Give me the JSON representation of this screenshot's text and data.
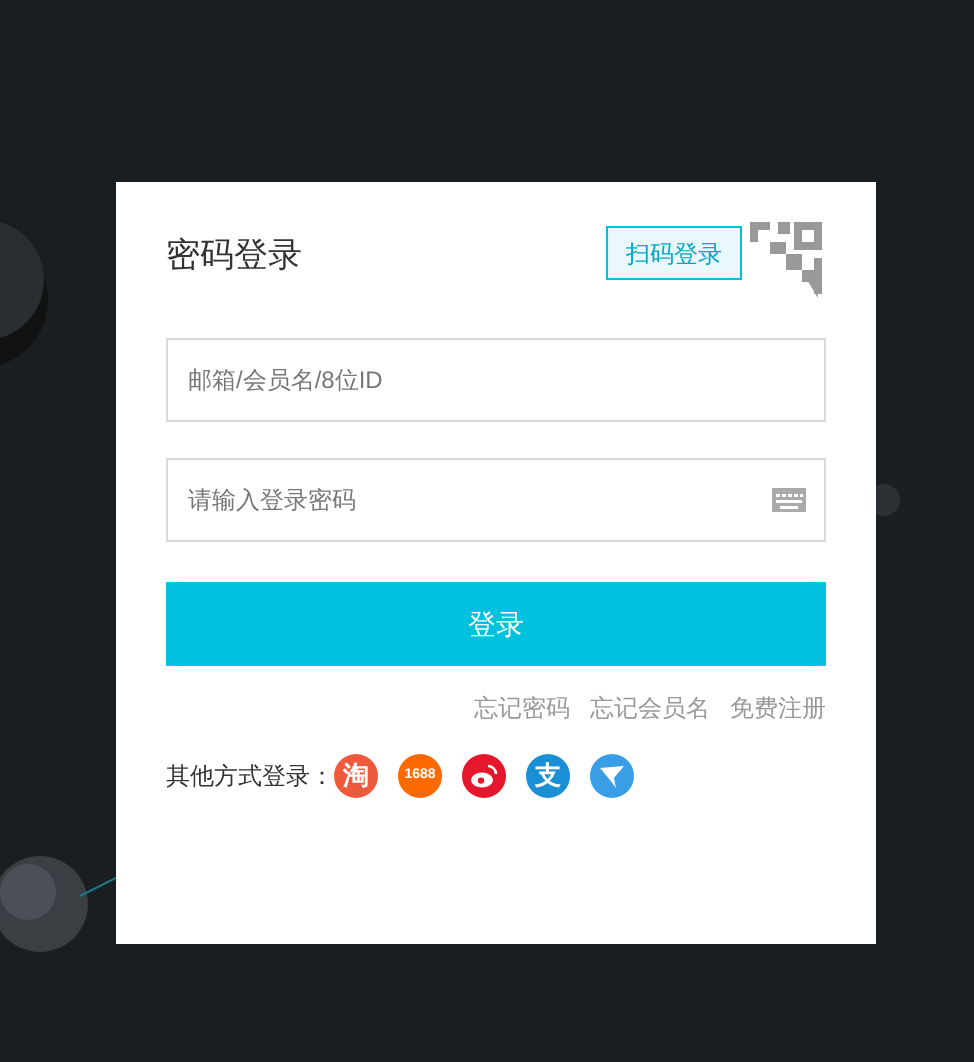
{
  "login_card": {
    "title": "密码登录",
    "qr_tip": "扫码登录",
    "account_field": {
      "placeholder": "邮箱/会员名/8位ID"
    },
    "password_field": {
      "placeholder": "请输入登录密码"
    },
    "submit": "登录",
    "links": [
      "忘记密码",
      "忘记会员名",
      "免费注册"
    ],
    "other_label": "其他方式登录：",
    "providers": [
      {
        "kind": "glyph",
        "label": "淘",
        "color": "#ef5a3c"
      },
      {
        "kind": "glyph",
        "label": "1688",
        "color": "#ff6a00"
      },
      {
        "kind": "weibo",
        "color": "#e6162d"
      },
      {
        "kind": "glyph",
        "label": "支",
        "color": "#1a8fd6"
      },
      {
        "kind": "plane",
        "color": "#3a9ee6"
      }
    ]
  }
}
